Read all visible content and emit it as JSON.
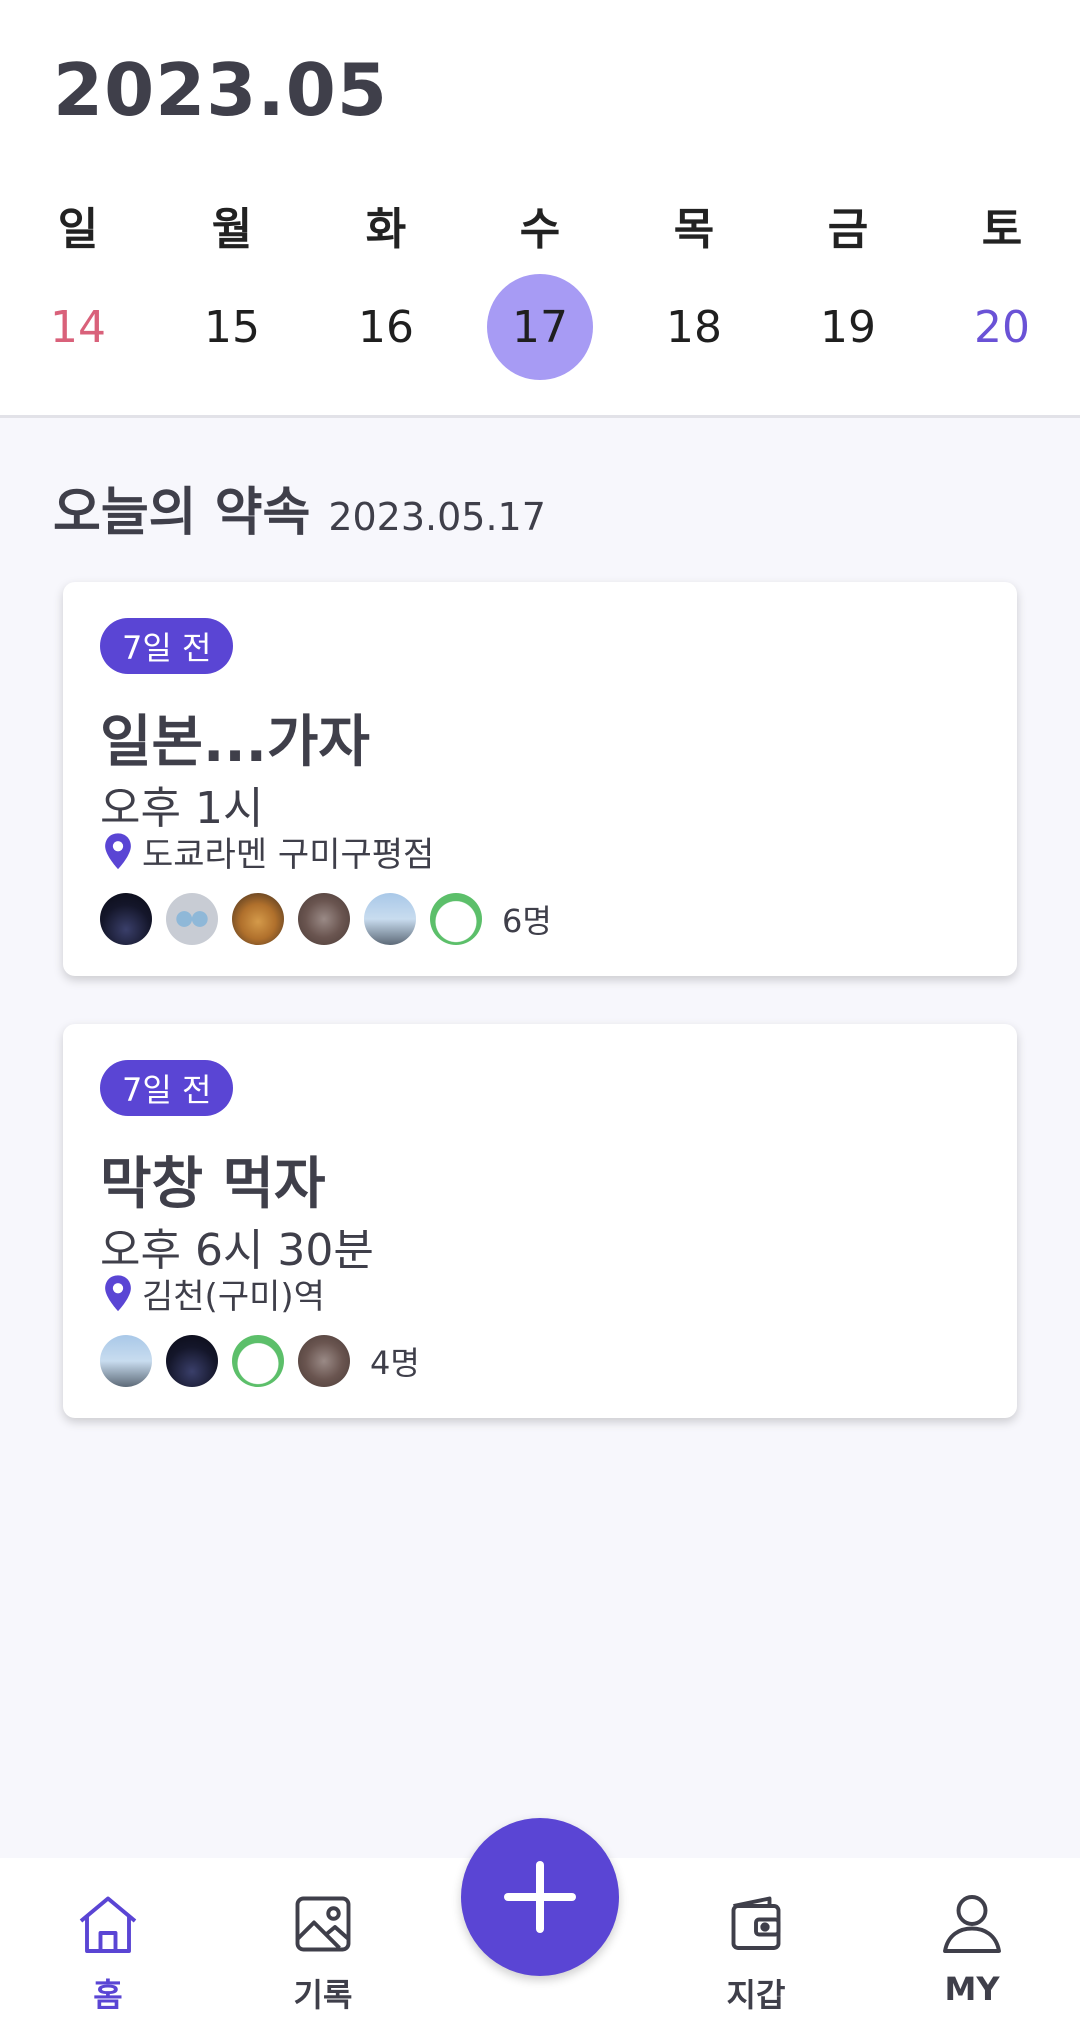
{
  "calendar": {
    "month_title": "2023.05",
    "weekdays": [
      "일",
      "월",
      "화",
      "수",
      "목",
      "금",
      "토"
    ],
    "dates": [
      "14",
      "15",
      "16",
      "17",
      "18",
      "19",
      "20"
    ],
    "selected_date": "17"
  },
  "section": {
    "title": "오늘의 약속",
    "date": "2023.05.17"
  },
  "appointments": [
    {
      "badge": "7일 전",
      "title": "일본...가자",
      "time": "오후 1시",
      "location": "도쿄라멘 구미구평점",
      "member_count": "6명",
      "avatars": [
        "avatar-night",
        "avatar-robot",
        "avatar-dog",
        "avatar-group",
        "avatar-sea",
        "avatar-white-dog"
      ]
    },
    {
      "badge": "7일 전",
      "title": "막창 먹자",
      "time": "오후 6시 30분",
      "location": "김천(구미)역",
      "member_count": "4명",
      "avatars": [
        "avatar-sea",
        "avatar-night",
        "avatar-white-dog",
        "avatar-group"
      ]
    }
  ],
  "nav": {
    "home": "홈",
    "records": "기록",
    "wallet": "지갑",
    "my": "MY"
  },
  "colors": {
    "accent": "#5a45d4",
    "selected_date_bg": "#a79bf4",
    "sunday": "#d9617a",
    "saturday": "#6a52d6"
  },
  "icons": {
    "fab": "plus-icon",
    "home": "home-icon",
    "records": "image-icon",
    "wallet": "wallet-icon",
    "my": "person-icon",
    "location": "location-pin-icon"
  }
}
